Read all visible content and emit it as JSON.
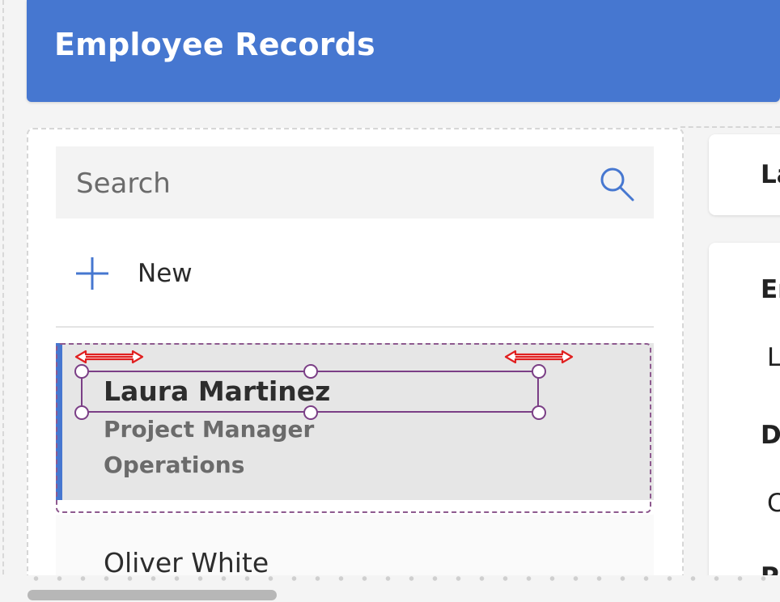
{
  "header": {
    "title": "Employee Records"
  },
  "gallery": {
    "search_placeholder": "Search",
    "new_label": "New",
    "items": [
      {
        "title": "Laura Martinez",
        "subtitle": "Project Manager",
        "body": "Operations"
      },
      {
        "title": "Oliver White"
      }
    ]
  },
  "detail": {
    "card1_label": "La",
    "card2_fields": [
      "Er",
      "L",
      "D",
      "C",
      "P"
    ]
  },
  "colors": {
    "accent": "#4677d0",
    "selection": "#7b3f86",
    "resize_arrow": "#e02020"
  },
  "icons": {
    "search": "search-icon",
    "add": "plus-icon"
  }
}
